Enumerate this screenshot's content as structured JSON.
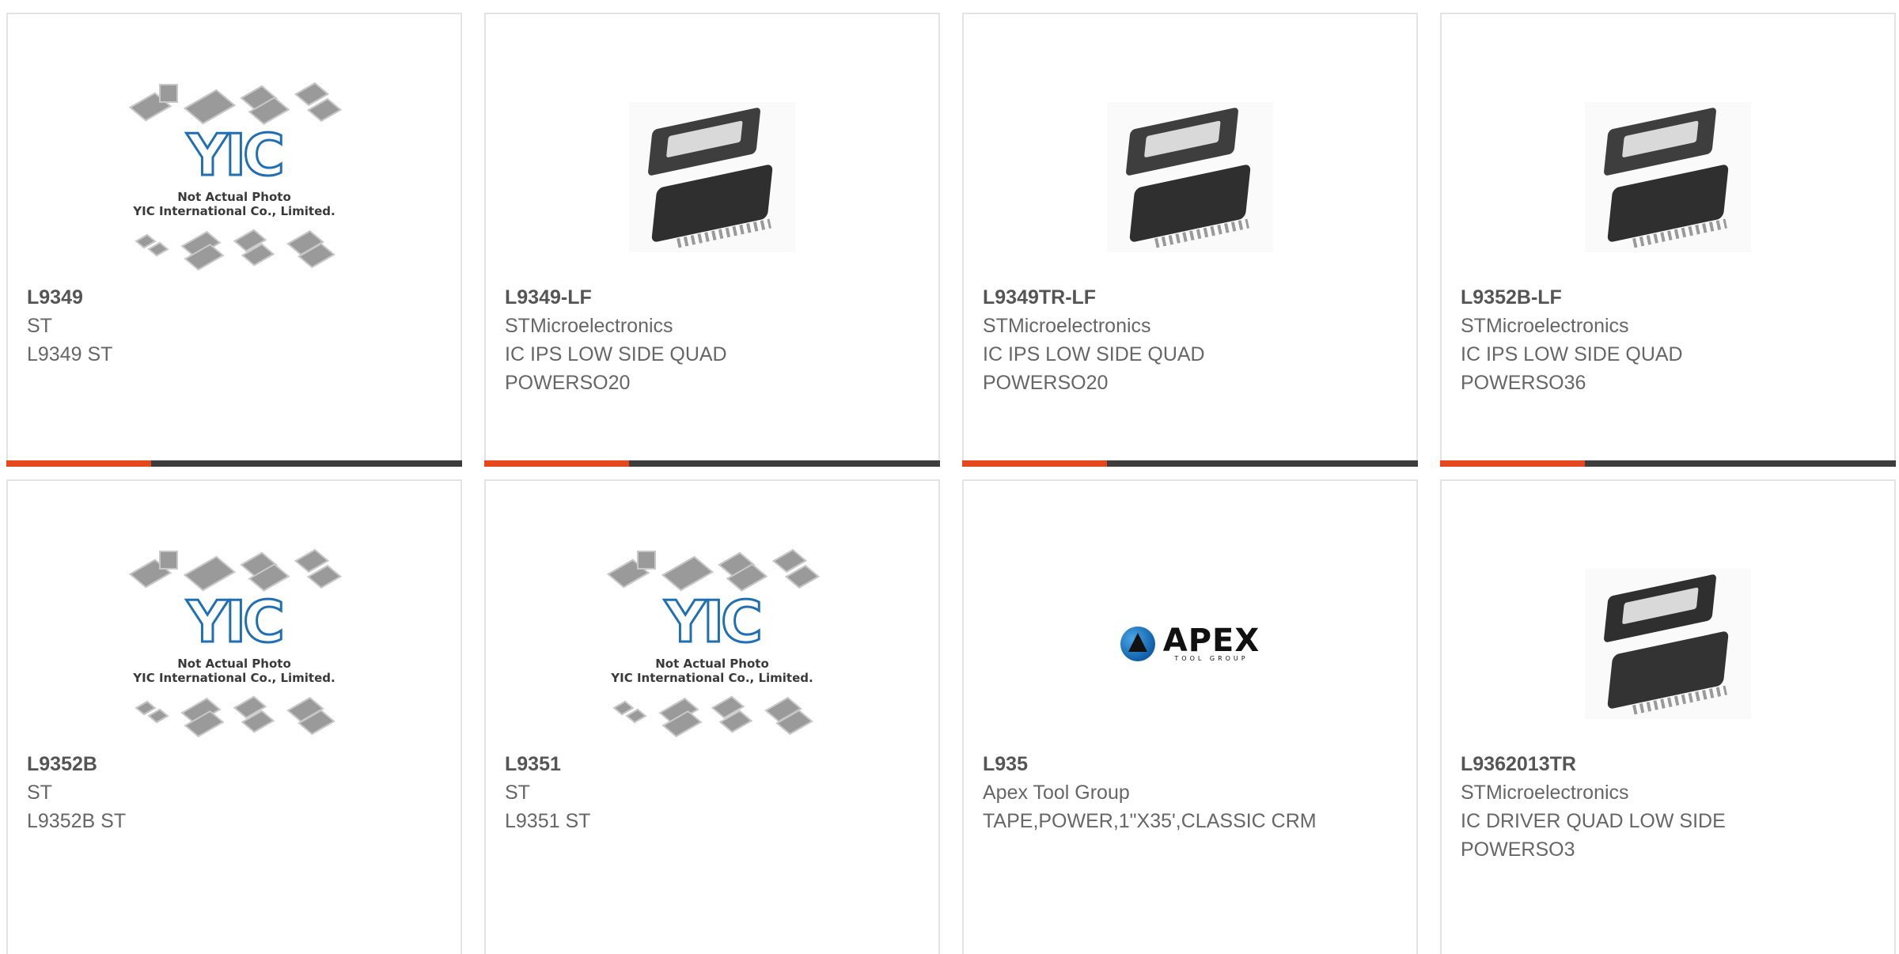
{
  "products": [
    {
      "part_number": "L9349",
      "manufacturer": "ST",
      "description": "L9349 ST",
      "image": "yic-placeholder",
      "has_bar": true
    },
    {
      "part_number": "L9349-LF",
      "manufacturer": "STMicroelectronics",
      "description": "IC IPS LOW SIDE QUAD POWERSO20",
      "image": "ic-package-photo",
      "has_bar": true
    },
    {
      "part_number": "L9349TR-LF",
      "manufacturer": "STMicroelectronics",
      "description": "IC IPS LOW SIDE QUAD POWERSO20",
      "image": "ic-package-photo",
      "has_bar": true
    },
    {
      "part_number": "L9352B-LF",
      "manufacturer": "STMicroelectronics",
      "description": "IC IPS LOW SIDE QUAD POWERSO36",
      "image": "ic-package-photo",
      "has_bar": true
    },
    {
      "part_number": "L9352B",
      "manufacturer": "ST",
      "description": "L9352B ST",
      "image": "yic-placeholder",
      "has_bar": false
    },
    {
      "part_number": "L9351",
      "manufacturer": "ST",
      "description": "L9351 ST",
      "image": "yic-placeholder",
      "has_bar": false
    },
    {
      "part_number": "L935",
      "manufacturer": "Apex Tool Group",
      "description": "TAPE,POWER,1\"X35',CLASSIC CRM",
      "image": "apex-logo",
      "has_bar": false
    },
    {
      "part_number": "L9362013TR",
      "manufacturer": "STMicroelectronics",
      "description": "IC DRIVER QUAD LOW SIDE POWERSO3",
      "image": "ic-package-photo",
      "has_bar": false
    }
  ],
  "placeholder": {
    "logo_text": "YIC",
    "note_line1": "Not Actual Photo",
    "note_line2": "YIC International Co., Limited."
  },
  "apex_logo": {
    "word": "APEX",
    "sub": "TOOL GROUP"
  },
  "colors": {
    "accent": "#e6471c",
    "bar": "#3d3d3d",
    "border": "#e3e3e3",
    "text": "#666666"
  }
}
